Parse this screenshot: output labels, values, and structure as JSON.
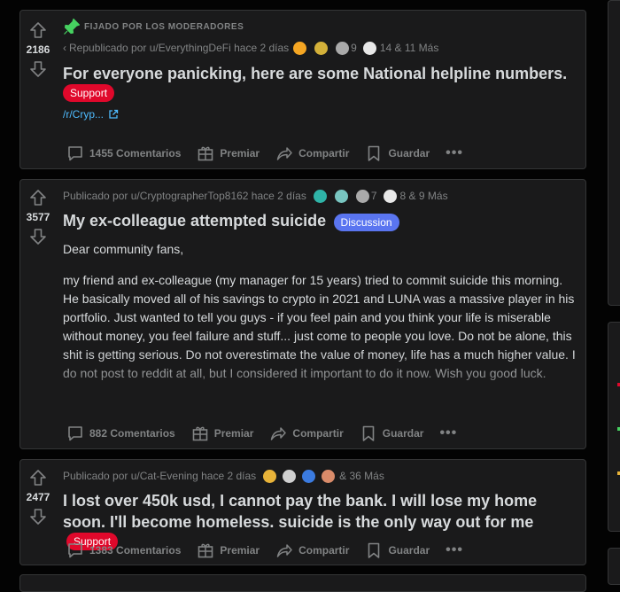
{
  "posts": [
    {
      "pinned_label": "FIJADO POR LOS MODERADORES",
      "votes": "2186",
      "meta": "Republicado por u/EverythingDeFi hace 2 días",
      "award_count_a": "9",
      "award_more": "14 & 11 Más",
      "title": "For everyone panicking, here are some National helpline numbers.",
      "flair": "Support",
      "link": "/r/Cryp...",
      "comments": "1455 Comentarios",
      "award_label": "Premiar",
      "share_label": "Compartir",
      "save_label": "Guardar"
    },
    {
      "votes": "3577",
      "meta": "Publicado por u/CryptographerTop8162 hace 2 días",
      "award_count_a": "7",
      "award_more": "8 & 9 Más",
      "title": "My ex-colleague attempted suicide",
      "flair": "Discussion",
      "body_p1": "Dear community fans,",
      "body_p2": "my friend and ex-colleague (my manager for 15 years) tried to commit suicide this morning. He basically moved all of his savings to crypto in 2021 and LUNA was a massive player in his portfolio. Just wanted to tell you guys - if you feel pain and you think your life is miserable without money, you feel failure and stuff... just come to people you love. Do not be alone, this shit is getting serious. Do not overestimate the value of money, life has a much higher value. I do not post to reddit at all, but I considered it important to do it now. Wish you good luck.",
      "comments": "882 Comentarios",
      "award_label": "Premiar",
      "share_label": "Compartir",
      "save_label": "Guardar"
    },
    {
      "votes": "2477",
      "meta": "Publicado por u/Cat-Evening hace 2 días",
      "award_more": "& 36 Más",
      "title": "I lost over 450k usd, I cannot pay the bank. I will lose my home soon. I'll become homeless. suicide is the only way out for me",
      "flair": "Support",
      "comments": "1383 Comentarios",
      "award_label": "Premiar",
      "share_label": "Compartir",
      "save_label": "Guardar"
    }
  ],
  "colors": {
    "background": "#030303",
    "card": "#1a1a1b",
    "border": "#343536",
    "muted": "#818384",
    "text": "#d7dadc",
    "support_flair": "#e0082b",
    "discussion_flair": "#5a75f0",
    "link": "#4fbcff",
    "pin": "#46d160"
  }
}
